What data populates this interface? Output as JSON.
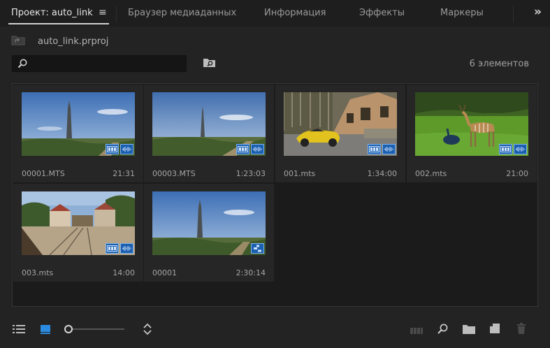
{
  "tabs": [
    {
      "label": "Проект: auto_link",
      "active": true
    },
    {
      "label": "Браузер медиаданных"
    },
    {
      "label": "Информация"
    },
    {
      "label": "Эффекты"
    },
    {
      "label": "Маркеры"
    }
  ],
  "tab_menu_icon": "hamburger-icon",
  "more_icon": "double-chevron-right-icon",
  "project": {
    "file_name": "auto_link.prproj",
    "icon": "folder-up-icon"
  },
  "search": {
    "value": "",
    "placeholder": "",
    "icon": "magnifier-icon"
  },
  "new_search_bin_icon": "folder-search-icon",
  "item_count": "6 элементов",
  "clips": [
    {
      "name": "00001.MTS",
      "duration": "21:31",
      "scene": "tower",
      "badges": [
        "video",
        "audio"
      ]
    },
    {
      "name": "00003.MTS",
      "duration": "1:23:03",
      "scene": "tower-far",
      "badges": [
        "video",
        "audio"
      ]
    },
    {
      "name": "001.mts",
      "duration": "1:34:00",
      "scene": "car",
      "badges": [
        "video",
        "audio"
      ]
    },
    {
      "name": "002.mts",
      "duration": "21:00",
      "scene": "zoo",
      "badges": [
        "video",
        "audio"
      ]
    },
    {
      "name": "003.mts",
      "duration": "14:00",
      "scene": "street",
      "badges": [
        "video",
        "audio"
      ]
    },
    {
      "name": "00001",
      "duration": "2:30:14",
      "scene": "tower",
      "badges": [
        "sequence"
      ]
    }
  ],
  "bottom_toolbar": {
    "list_view_icon": "list-view-icon",
    "icon_view_icon": "icon-view-icon",
    "zoom_level": 0,
    "sort_icon": "sort-arrows-icon",
    "automate_icon": "automate-to-sequence-icon",
    "find_icon": "find-icon",
    "new_bin_icon": "new-bin-icon",
    "new_item_icon": "new-item-icon",
    "clear_icon": "trash-icon"
  },
  "colors": {
    "accent": "#2a8ce0",
    "badge": "#1b5fb0",
    "background": "#232323"
  }
}
